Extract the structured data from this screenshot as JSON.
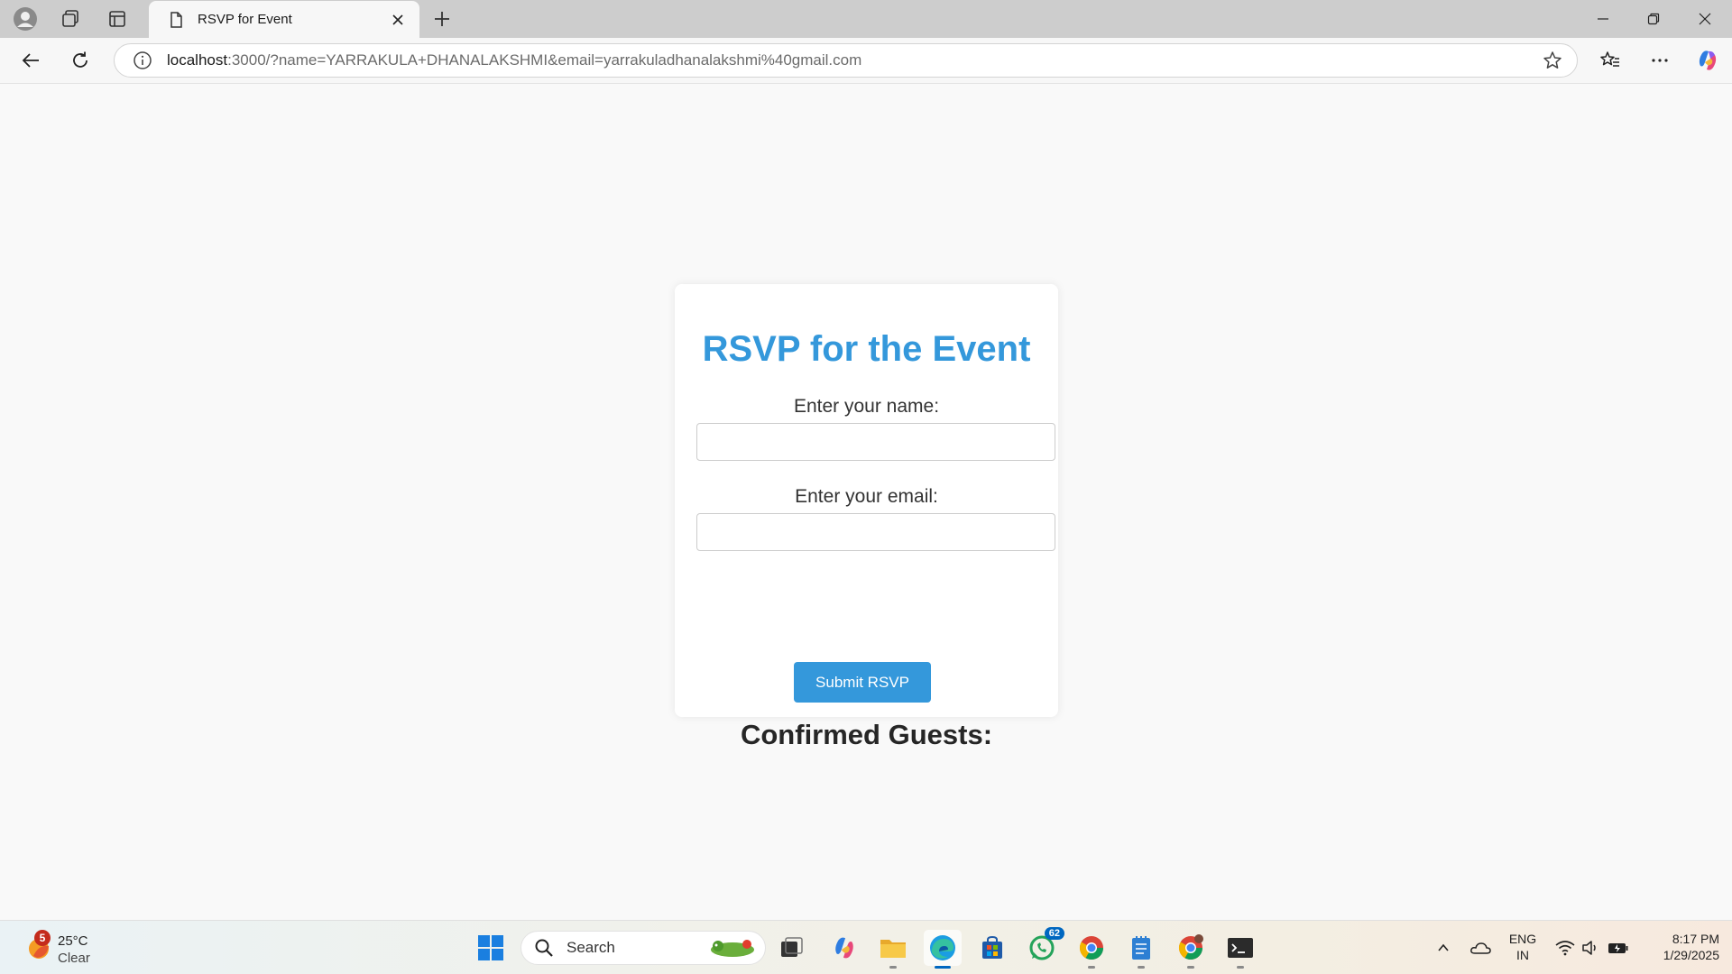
{
  "browser": {
    "tab_title": "RSVP for Event",
    "url_host": "localhost",
    "url_rest": ":3000/?name=YARRAKULA+DHANALAKSHMI&email=yarrakuladhanalakshmi%40gmail.com"
  },
  "page": {
    "heading": "RSVP for the Event",
    "name_label": "Enter your name:",
    "name_value": "",
    "email_label": "Enter your email:",
    "email_value": "",
    "submit_label": "Submit RSVP",
    "guests_heading": "Confirmed Guests:"
  },
  "taskbar": {
    "weather_badge": "5",
    "temperature": "25°C",
    "condition": "Clear",
    "search_placeholder": "Search",
    "whatsapp_badge": "62",
    "lang_line1": "ENG",
    "lang_line2": "IN",
    "time": "8:17 PM",
    "date": "1/29/2025"
  },
  "colors": {
    "accent": "#3498db",
    "heading_dark": "#262626"
  }
}
